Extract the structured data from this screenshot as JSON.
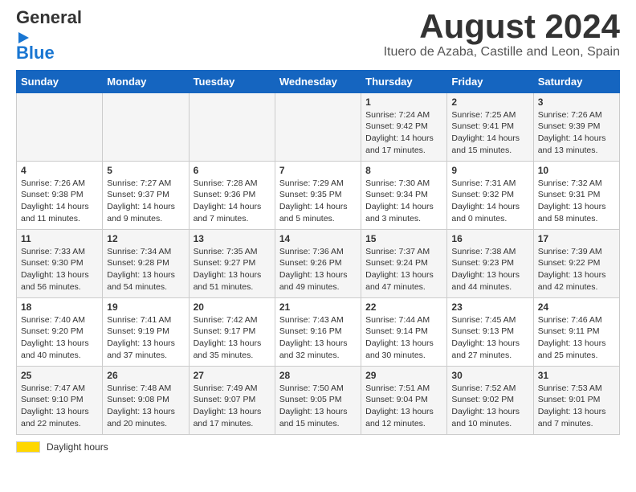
{
  "header": {
    "logo_line1": "General",
    "logo_line2": "Blue",
    "month_title": "August 2024",
    "location": "Ituero de Azaba, Castille and Leon, Spain"
  },
  "days_of_week": [
    "Sunday",
    "Monday",
    "Tuesday",
    "Wednesday",
    "Thursday",
    "Friday",
    "Saturday"
  ],
  "weeks": [
    [
      {
        "day": "",
        "sunrise": "",
        "sunset": "",
        "daylight": ""
      },
      {
        "day": "",
        "sunrise": "",
        "sunset": "",
        "daylight": ""
      },
      {
        "day": "",
        "sunrise": "",
        "sunset": "",
        "daylight": ""
      },
      {
        "day": "",
        "sunrise": "",
        "sunset": "",
        "daylight": ""
      },
      {
        "day": "1",
        "sunrise": "Sunrise: 7:24 AM",
        "sunset": "Sunset: 9:42 PM",
        "daylight": "Daylight: 14 hours and 17 minutes."
      },
      {
        "day": "2",
        "sunrise": "Sunrise: 7:25 AM",
        "sunset": "Sunset: 9:41 PM",
        "daylight": "Daylight: 14 hours and 15 minutes."
      },
      {
        "day": "3",
        "sunrise": "Sunrise: 7:26 AM",
        "sunset": "Sunset: 9:39 PM",
        "daylight": "Daylight: 14 hours and 13 minutes."
      }
    ],
    [
      {
        "day": "4",
        "sunrise": "Sunrise: 7:26 AM",
        "sunset": "Sunset: 9:38 PM",
        "daylight": "Daylight: 14 hours and 11 minutes."
      },
      {
        "day": "5",
        "sunrise": "Sunrise: 7:27 AM",
        "sunset": "Sunset: 9:37 PM",
        "daylight": "Daylight: 14 hours and 9 minutes."
      },
      {
        "day": "6",
        "sunrise": "Sunrise: 7:28 AM",
        "sunset": "Sunset: 9:36 PM",
        "daylight": "Daylight: 14 hours and 7 minutes."
      },
      {
        "day": "7",
        "sunrise": "Sunrise: 7:29 AM",
        "sunset": "Sunset: 9:35 PM",
        "daylight": "Daylight: 14 hours and 5 minutes."
      },
      {
        "day": "8",
        "sunrise": "Sunrise: 7:30 AM",
        "sunset": "Sunset: 9:34 PM",
        "daylight": "Daylight: 14 hours and 3 minutes."
      },
      {
        "day": "9",
        "sunrise": "Sunrise: 7:31 AM",
        "sunset": "Sunset: 9:32 PM",
        "daylight": "Daylight: 14 hours and 0 minutes."
      },
      {
        "day": "10",
        "sunrise": "Sunrise: 7:32 AM",
        "sunset": "Sunset: 9:31 PM",
        "daylight": "Daylight: 13 hours and 58 minutes."
      }
    ],
    [
      {
        "day": "11",
        "sunrise": "Sunrise: 7:33 AM",
        "sunset": "Sunset: 9:30 PM",
        "daylight": "Daylight: 13 hours and 56 minutes."
      },
      {
        "day": "12",
        "sunrise": "Sunrise: 7:34 AM",
        "sunset": "Sunset: 9:28 PM",
        "daylight": "Daylight: 13 hours and 54 minutes."
      },
      {
        "day": "13",
        "sunrise": "Sunrise: 7:35 AM",
        "sunset": "Sunset: 9:27 PM",
        "daylight": "Daylight: 13 hours and 51 minutes."
      },
      {
        "day": "14",
        "sunrise": "Sunrise: 7:36 AM",
        "sunset": "Sunset: 9:26 PM",
        "daylight": "Daylight: 13 hours and 49 minutes."
      },
      {
        "day": "15",
        "sunrise": "Sunrise: 7:37 AM",
        "sunset": "Sunset: 9:24 PM",
        "daylight": "Daylight: 13 hours and 47 minutes."
      },
      {
        "day": "16",
        "sunrise": "Sunrise: 7:38 AM",
        "sunset": "Sunset: 9:23 PM",
        "daylight": "Daylight: 13 hours and 44 minutes."
      },
      {
        "day": "17",
        "sunrise": "Sunrise: 7:39 AM",
        "sunset": "Sunset: 9:22 PM",
        "daylight": "Daylight: 13 hours and 42 minutes."
      }
    ],
    [
      {
        "day": "18",
        "sunrise": "Sunrise: 7:40 AM",
        "sunset": "Sunset: 9:20 PM",
        "daylight": "Daylight: 13 hours and 40 minutes."
      },
      {
        "day": "19",
        "sunrise": "Sunrise: 7:41 AM",
        "sunset": "Sunset: 9:19 PM",
        "daylight": "Daylight: 13 hours and 37 minutes."
      },
      {
        "day": "20",
        "sunrise": "Sunrise: 7:42 AM",
        "sunset": "Sunset: 9:17 PM",
        "daylight": "Daylight: 13 hours and 35 minutes."
      },
      {
        "day": "21",
        "sunrise": "Sunrise: 7:43 AM",
        "sunset": "Sunset: 9:16 PM",
        "daylight": "Daylight: 13 hours and 32 minutes."
      },
      {
        "day": "22",
        "sunrise": "Sunrise: 7:44 AM",
        "sunset": "Sunset: 9:14 PM",
        "daylight": "Daylight: 13 hours and 30 minutes."
      },
      {
        "day": "23",
        "sunrise": "Sunrise: 7:45 AM",
        "sunset": "Sunset: 9:13 PM",
        "daylight": "Daylight: 13 hours and 27 minutes."
      },
      {
        "day": "24",
        "sunrise": "Sunrise: 7:46 AM",
        "sunset": "Sunset: 9:11 PM",
        "daylight": "Daylight: 13 hours and 25 minutes."
      }
    ],
    [
      {
        "day": "25",
        "sunrise": "Sunrise: 7:47 AM",
        "sunset": "Sunset: 9:10 PM",
        "daylight": "Daylight: 13 hours and 22 minutes."
      },
      {
        "day": "26",
        "sunrise": "Sunrise: 7:48 AM",
        "sunset": "Sunset: 9:08 PM",
        "daylight": "Daylight: 13 hours and 20 minutes."
      },
      {
        "day": "27",
        "sunrise": "Sunrise: 7:49 AM",
        "sunset": "Sunset: 9:07 PM",
        "daylight": "Daylight: 13 hours and 17 minutes."
      },
      {
        "day": "28",
        "sunrise": "Sunrise: 7:50 AM",
        "sunset": "Sunset: 9:05 PM",
        "daylight": "Daylight: 13 hours and 15 minutes."
      },
      {
        "day": "29",
        "sunrise": "Sunrise: 7:51 AM",
        "sunset": "Sunset: 9:04 PM",
        "daylight": "Daylight: 13 hours and 12 minutes."
      },
      {
        "day": "30",
        "sunrise": "Sunrise: 7:52 AM",
        "sunset": "Sunset: 9:02 PM",
        "daylight": "Daylight: 13 hours and 10 minutes."
      },
      {
        "day": "31",
        "sunrise": "Sunrise: 7:53 AM",
        "sunset": "Sunset: 9:01 PM",
        "daylight": "Daylight: 13 hours and 7 minutes."
      }
    ]
  ],
  "legend": {
    "daylight_label": "Daylight hours"
  }
}
